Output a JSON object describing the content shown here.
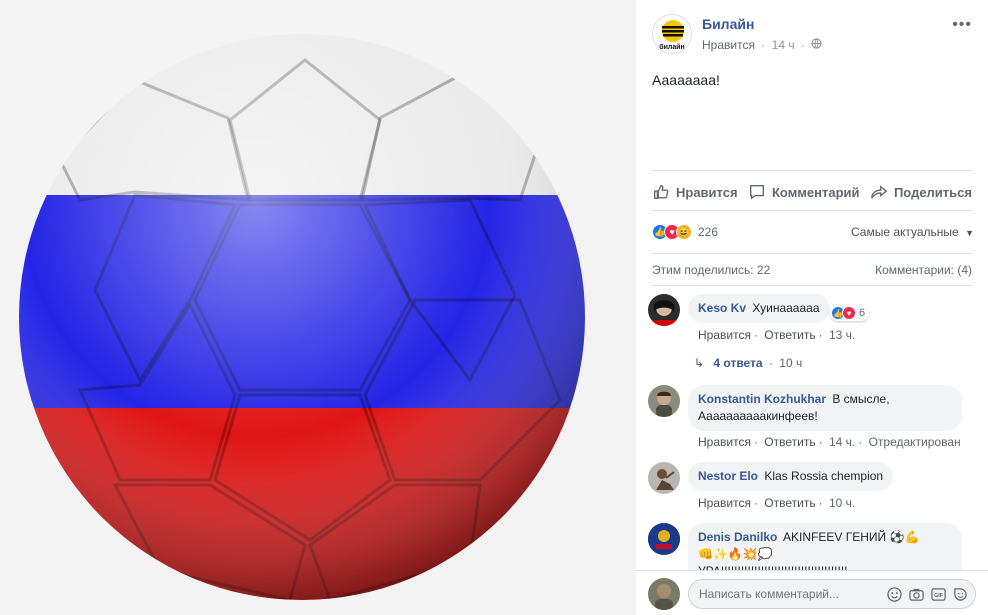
{
  "page": {
    "name": "Билайн",
    "logo_text": "билайн"
  },
  "post": {
    "like_label": "Нравится",
    "time": "14 ч",
    "text": "Аааааааа!"
  },
  "actions": {
    "like": "Нравится",
    "comment": "Комментарий",
    "share": "Поделиться"
  },
  "reactions": {
    "count": "226",
    "sort": "Самые актуальные"
  },
  "stats": {
    "shares": "Этим поделились: 22",
    "comments": "Комментарии: (4)"
  },
  "comments": [
    {
      "author": "Keso Kv",
      "text": "Хуинаааааа",
      "like": "Нравится",
      "reply": "Ответить",
      "time": "13 ч.",
      "reactions": "6"
    },
    {
      "author": "Konstantin Kozhukhar",
      "text_line1": "В смысле,",
      "text_line2": "Аааааааааакинфеев!",
      "like": "Нравится",
      "reply": "Ответить",
      "time": "14 ч.",
      "edited": "Отредактирован"
    },
    {
      "author": "Nestor Elo",
      "text": "Klas Rossia chempion",
      "like": "Нравится",
      "reply": "Ответить",
      "time": "10 ч."
    },
    {
      "author": "Denis Danilko",
      "text": "AKINFEEV ГЕНИЙ",
      "text_line3": "УРА!!!!!!!!!!!!!!!!!!!!!!!!!!!!!!!!!!!!!!"
    }
  ],
  "replies": {
    "label": "4 ответа",
    "time": "10 ч"
  },
  "composer": {
    "placeholder": "Написать комментарий..."
  },
  "colors": {
    "link": "#385898",
    "like_blue": "#1877f2",
    "love_red": "#f0284a",
    "haha_yellow": "#f7b125"
  }
}
